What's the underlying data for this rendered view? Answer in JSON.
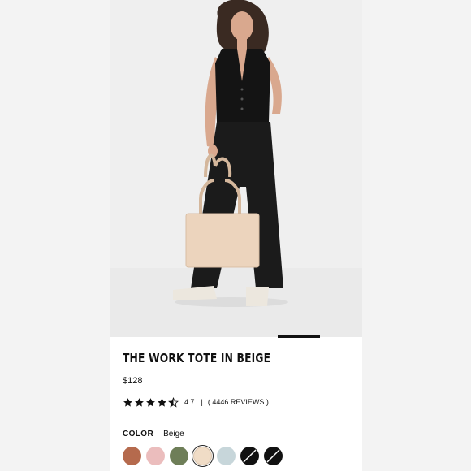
{
  "product": {
    "title": "THE WORK TOTE IN BEIGE",
    "price": "$128",
    "rating": {
      "value": "4.7",
      "stars": 4.5,
      "separator": "|",
      "reviews": "( 4446 REVIEWS )"
    },
    "color": {
      "label": "COLOR",
      "selected": "Beige"
    },
    "swatches": [
      {
        "color": "#b56a4d",
        "state": "available"
      },
      {
        "color": "#ebbdbd",
        "state": "available"
      },
      {
        "color": "#6e7e58",
        "state": "available"
      },
      {
        "color": "#f0dcc6",
        "state": "selected"
      },
      {
        "color": "#c7d6da",
        "state": "available"
      },
      {
        "color": "#111111",
        "state": "sold-out"
      },
      {
        "color": "#111111",
        "state": "sold-out"
      }
    ]
  },
  "carousel": {
    "indicator_color": "#111111"
  },
  "hero_image": {
    "alt_subject": "model-holding-tote",
    "background": "#efefef"
  }
}
